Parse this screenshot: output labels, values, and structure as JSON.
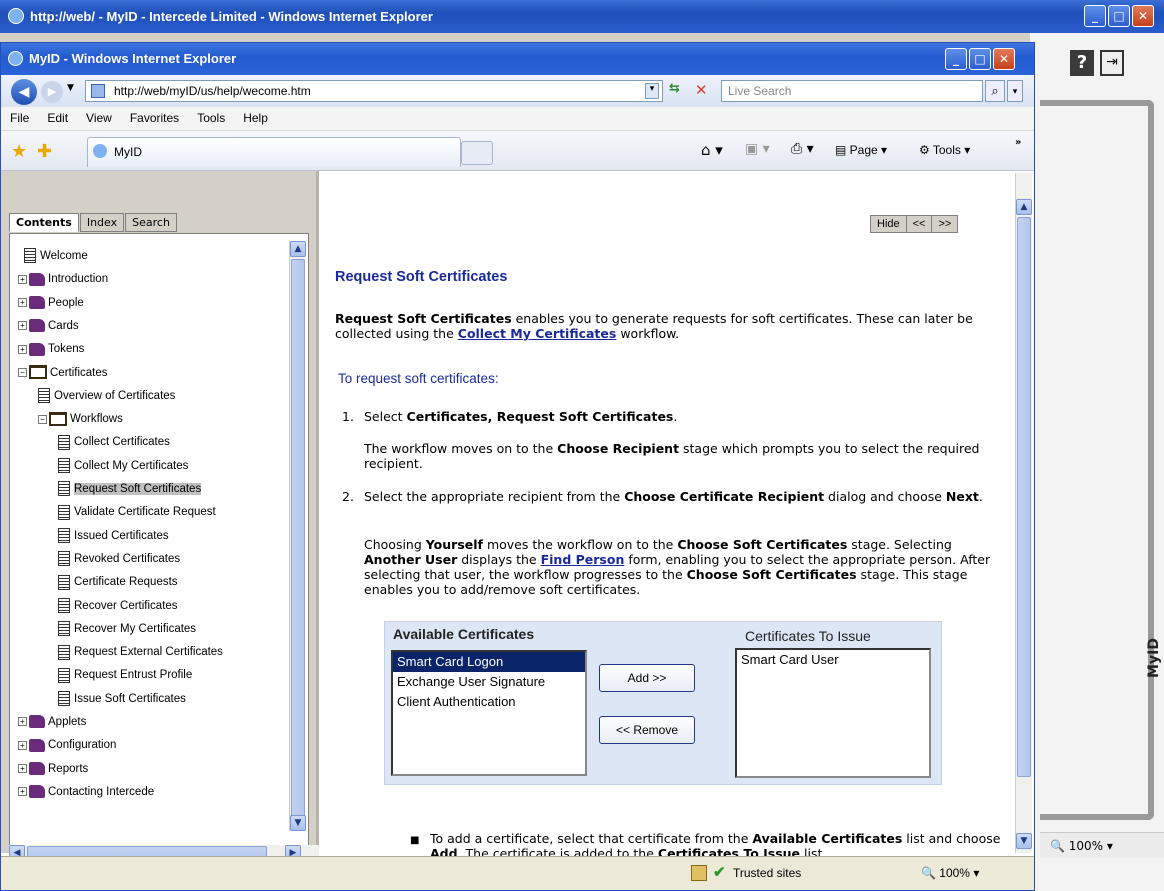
{
  "outer_window": {
    "title": "http://web/ - MyID - Intercede Limited - Windows Internet Explorer",
    "zoom": "100%"
  },
  "window": {
    "title": "MyID - Windows Internet Explorer"
  },
  "address": {
    "url": "http://web/myID/us/help/wecome.htm",
    "search_placeholder": "Live Search"
  },
  "menu": [
    "File",
    "Edit",
    "View",
    "Favorites",
    "Tools",
    "Help"
  ],
  "favbar": {
    "tab_label": "MyID",
    "page_label": "Page",
    "tools_label": "Tools"
  },
  "help_nav": {
    "tabs": [
      "Contents",
      "Index",
      "Search"
    ],
    "hide": "Hide",
    "back": "<<",
    "forward": ">>"
  },
  "tree": [
    {
      "label": "Welcome",
      "type": "page",
      "indent": 0
    },
    {
      "label": "Introduction",
      "type": "book",
      "indent": 0
    },
    {
      "label": "People",
      "type": "book",
      "indent": 0
    },
    {
      "label": "Cards",
      "type": "book",
      "indent": 0
    },
    {
      "label": "Tokens",
      "type": "book",
      "indent": 0
    },
    {
      "label": "Certificates",
      "type": "open",
      "indent": 0
    },
    {
      "label": "Overview of Certificates",
      "type": "page",
      "indent": 1
    },
    {
      "label": "Workflows",
      "type": "open",
      "indent": 1
    },
    {
      "label": "Collect Certificates",
      "type": "page",
      "indent": 2
    },
    {
      "label": "Collect My Certificates",
      "type": "page",
      "indent": 2
    },
    {
      "label": "Request Soft Certificates",
      "type": "page",
      "indent": 2,
      "selected": true
    },
    {
      "label": "Validate Certificate Request",
      "type": "page",
      "indent": 2
    },
    {
      "label": "Issued Certificates",
      "type": "page",
      "indent": 2
    },
    {
      "label": "Revoked Certificates",
      "type": "page",
      "indent": 2
    },
    {
      "label": "Certificate Requests",
      "type": "page",
      "indent": 2
    },
    {
      "label": "Recover Certificates",
      "type": "page",
      "indent": 2
    },
    {
      "label": "Recover My Certificates",
      "type": "page",
      "indent": 2
    },
    {
      "label": "Request External Certificates",
      "type": "page",
      "indent": 2
    },
    {
      "label": "Request Entrust Profile",
      "type": "page",
      "indent": 2
    },
    {
      "label": "Issue Soft Certificates",
      "type": "page",
      "indent": 2
    },
    {
      "label": "Applets",
      "type": "book",
      "indent": 0
    },
    {
      "label": "Configuration",
      "type": "book",
      "indent": 0
    },
    {
      "label": "Reports",
      "type": "book",
      "indent": 0
    },
    {
      "label": "Contacting Intercede",
      "type": "book",
      "indent": 0
    }
  ],
  "article": {
    "title": "Request Soft Certificates",
    "intro_bold": "Request Soft Certificates",
    "intro_rest": " enables you to generate requests for soft certificates. These can later be collected using the ",
    "intro_link": "Collect My Certificates",
    "intro_end": " workflow.",
    "subhead": "To request soft certificates:",
    "step1_num": "1.",
    "step1_pre": "Select ",
    "step1_bold": "Certificates, Request Soft Certificates",
    "step1_end": ".",
    "step1_note_pre": "The workflow moves on to the ",
    "step1_note_bold": "Choose Recipient",
    "step1_note_end": " stage which prompts you to select the required recipient.",
    "step2_num": "2.",
    "step2_pre": "Select the appropriate recipient from the ",
    "step2_bold": "Choose Certificate Recipient",
    "step2_mid": " dialog and choose ",
    "step2_bold2": "Next",
    "step2_end": ".",
    "p3_a": "Choosing ",
    "p3_b": "Yourself",
    "p3_c": " moves the workflow on to the ",
    "p3_d": "Choose Soft Certificates",
    "p3_e": " stage. Selecting ",
    "p3_f": "Another User",
    "p3_g": " displays the ",
    "p3_link": "Find Person",
    "p3_h": " form, enabling you to select the appropriate person. After selecting that user, the workflow progresses to the ",
    "p3_i": "Choose Soft Certificates",
    "p3_j": " stage. This stage enables you to add/remove soft certificates.",
    "available_title": "Available Certificates",
    "issue_title": "Certificates To Issue",
    "available": [
      "Smart Card Logon",
      "Exchange User Signature",
      "Client Authentication"
    ],
    "to_issue": [
      "Smart Card User"
    ],
    "add_btn": "Add >>",
    "remove_btn": "<< Remove",
    "bullet_a": "To add a certificate, select that certificate from the ",
    "bullet_b": "Available Certificates",
    "bullet_c": " list and choose ",
    "bullet_d": "Add",
    "bullet_e": ". The certificate is added to the ",
    "bullet_f": "Certificates To Issue",
    "bullet_g": " list."
  },
  "status": {
    "zone": "Trusted sites",
    "zoom": "100%"
  },
  "brand": "MyID"
}
